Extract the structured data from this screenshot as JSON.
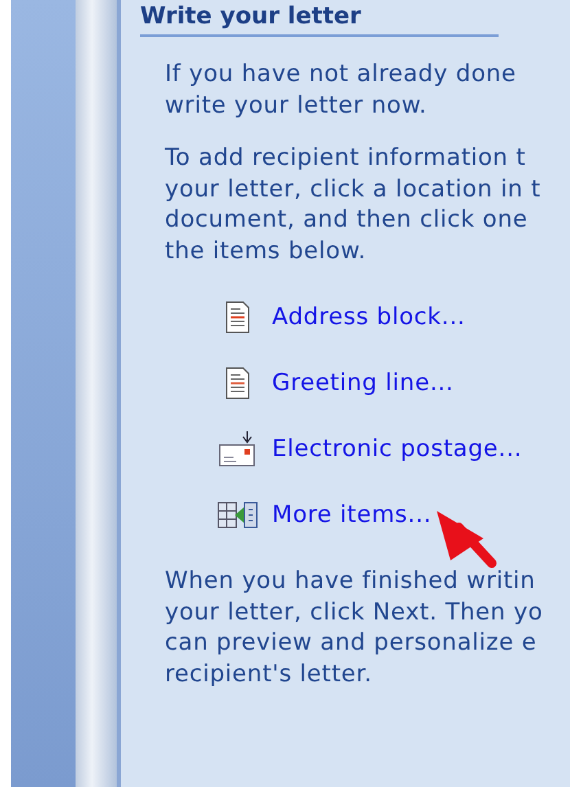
{
  "heading": "Write your letter",
  "intro": [
    {
      "lines": [
        "If you have not already done",
        "write your letter now."
      ]
    },
    {
      "lines": [
        "To add recipient information t",
        "your letter, click a location in t",
        "document, and then click one",
        "the items below."
      ]
    }
  ],
  "items": [
    {
      "kind": "address",
      "label": "Address block..."
    },
    {
      "kind": "greeting",
      "label": "Greeting line..."
    },
    {
      "kind": "postage",
      "label": "Electronic postage..."
    },
    {
      "kind": "more",
      "label": "More items..."
    }
  ],
  "outro": {
    "lines": [
      "When you have finished writin",
      "your letter, click Next. Then yo",
      "can preview and personalize e",
      "recipient's letter."
    ]
  }
}
